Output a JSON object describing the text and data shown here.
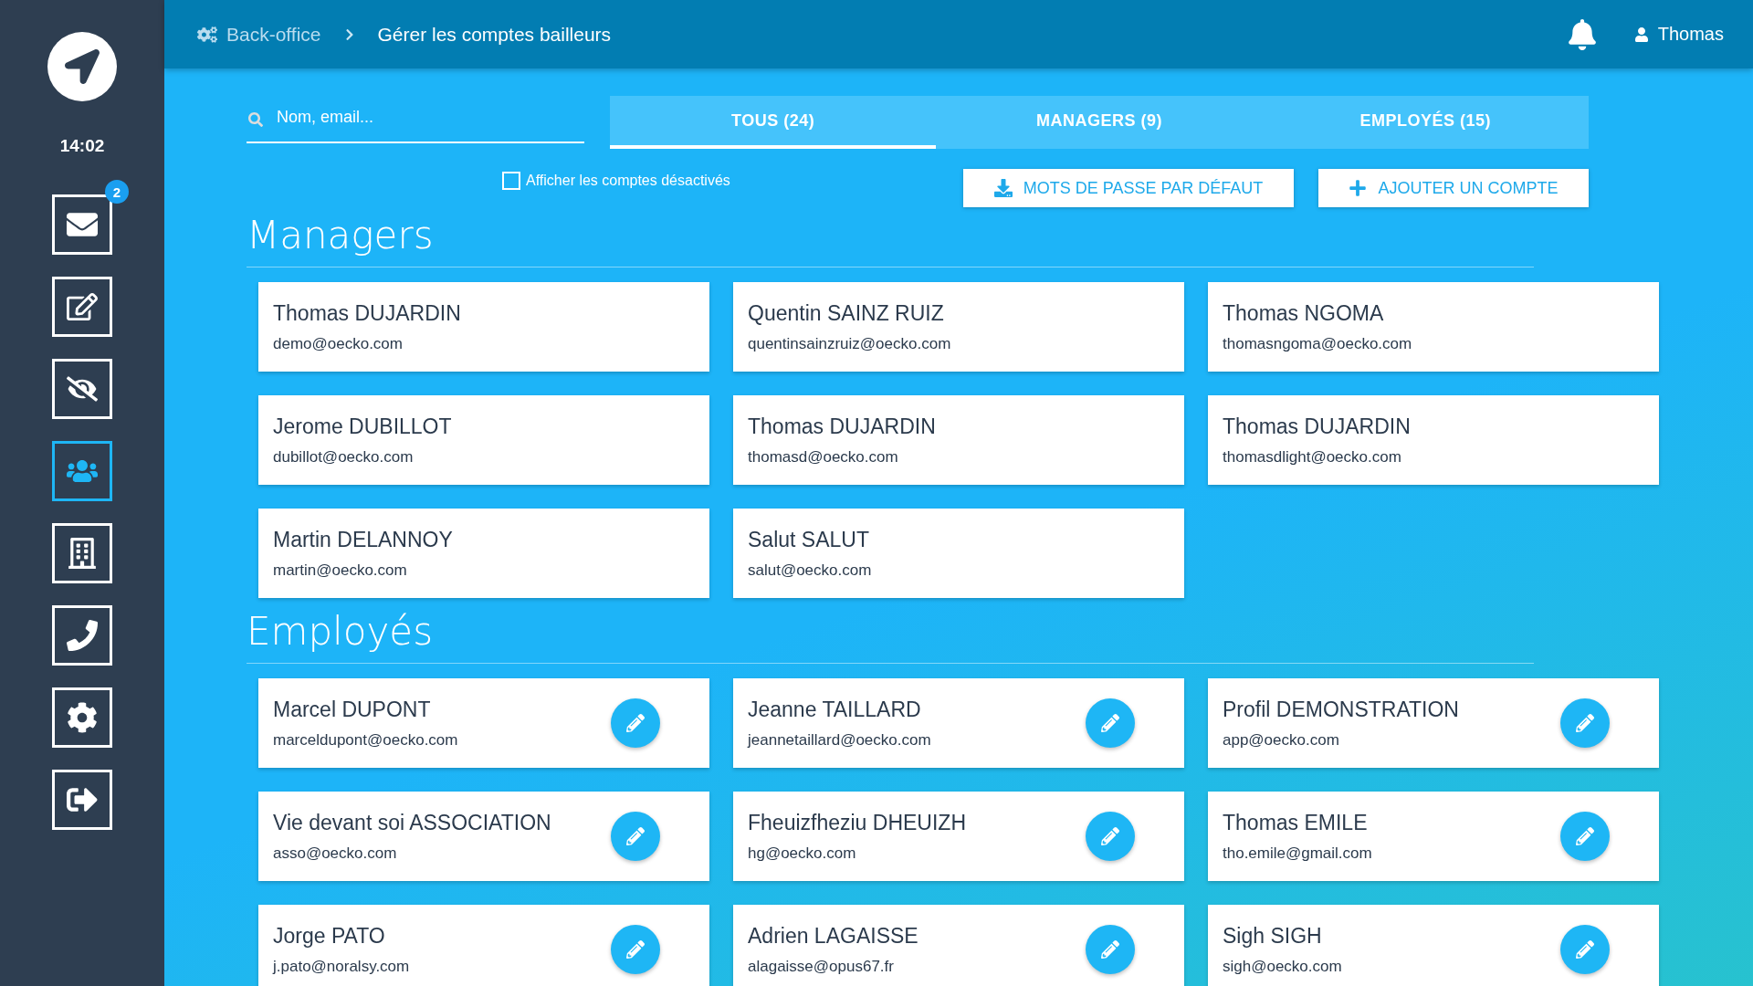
{
  "sidebar": {
    "time": "14:02",
    "items": [
      {
        "badge": "2",
        "selected": false
      },
      {
        "selected": false
      },
      {
        "selected": false
      },
      {
        "selected": true
      },
      {
        "selected": false
      },
      {
        "selected": false
      },
      {
        "selected": false
      },
      {
        "selected": false
      }
    ]
  },
  "header": {
    "breadcrumb": [
      "Back-office",
      "Gérer les comptes bailleurs"
    ],
    "user": "Thomas"
  },
  "search": {
    "placeholder": "Nom, email..."
  },
  "tabs": [
    {
      "label": "TOUS (24)",
      "selected": true
    },
    {
      "label": "MANAGERS (9)",
      "selected": false
    },
    {
      "label": "EMPLOYÉS (15)",
      "selected": false
    }
  ],
  "show_disabled": {
    "label": "Afficher les comptes désactivés",
    "checked": false
  },
  "actions": [
    {
      "kind": "download",
      "label": "MOTS DE PASSE PAR DÉFAUT"
    },
    {
      "kind": "add",
      "label": "AJOUTER UN COMPTE"
    }
  ],
  "sections": [
    {
      "title": "Managers",
      "editable": false,
      "cards": [
        {
          "name": "Thomas DUJARDIN",
          "email": "demo@oecko.com"
        },
        {
          "name": "Quentin SAINZ RUIZ",
          "email": "quentinsainzruiz@oecko.com"
        },
        {
          "name": "Thomas NGOMA",
          "email": "thomasngoma@oecko.com"
        },
        {
          "name": "Jerome DUBILLOT",
          "email": "dubillot@oecko.com"
        },
        {
          "name": "Thomas DUJARDIN",
          "email": "thomasd@oecko.com"
        },
        {
          "name": "Thomas DUJARDIN",
          "email": "thomasdlight@oecko.com"
        },
        {
          "name": "Martin DELANNOY",
          "email": "martin@oecko.com"
        },
        {
          "name": "Salut SALUT",
          "email": "salut@oecko.com"
        }
      ]
    },
    {
      "title": "Employés",
      "editable": true,
      "cards": [
        {
          "name": "Marcel DUPONT",
          "email": "marceldupont@oecko.com"
        },
        {
          "name": "Jeanne TAILLARD",
          "email": "jeannetaillard@oecko.com"
        },
        {
          "name": "Profil DEMONSTRATION",
          "email": "app@oecko.com"
        },
        {
          "name": "Vie devant soi ASSOCIATION",
          "email": "asso@oecko.com"
        },
        {
          "name": "Fheuizfheziu DHEUIZH",
          "email": "hg@oecko.com"
        },
        {
          "name": "Thomas EMILE",
          "email": "tho.emile@gmail.com"
        },
        {
          "name": "Jorge PATO",
          "email": "j.pato@noralsy.com"
        },
        {
          "name": "Adrien LAGAISSE",
          "email": "alagaisse@opus67.fr"
        },
        {
          "name": "Sigh SIGH",
          "email": "sigh@oecko.com"
        }
      ]
    }
  ]
}
